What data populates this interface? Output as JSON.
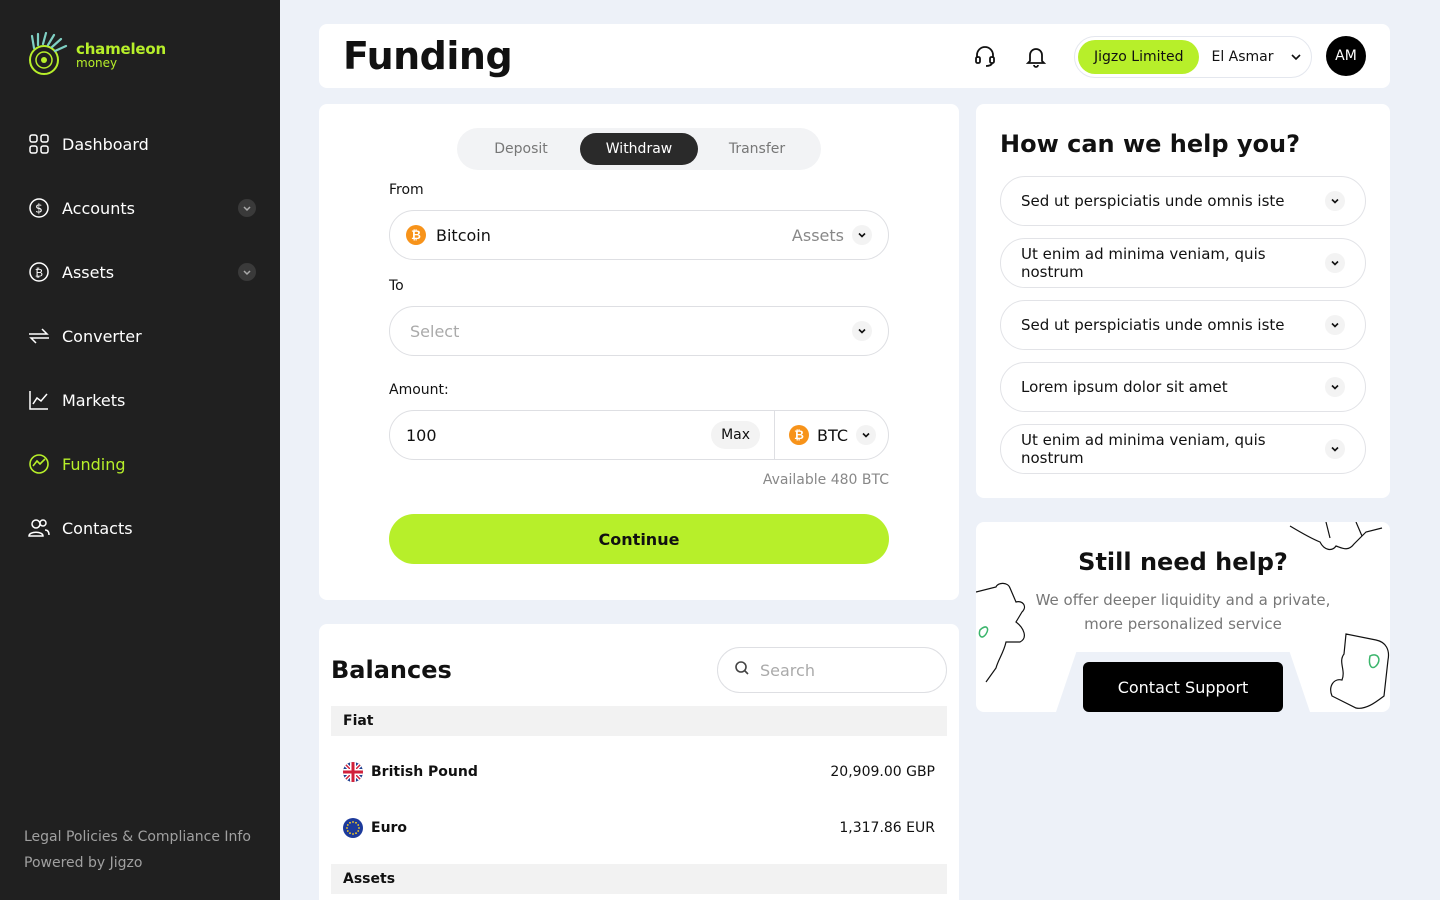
{
  "brand": {
    "name": "chameleon",
    "sub": "money"
  },
  "sidebar": {
    "items": [
      {
        "label": "Dashboard",
        "icon": "grid-icon"
      },
      {
        "label": "Accounts",
        "icon": "dollar-icon"
      },
      {
        "label": "Assets",
        "icon": "bitcoin-icon"
      },
      {
        "label": "Converter",
        "icon": "arrows-icon"
      },
      {
        "label": "Markets",
        "icon": "chart-icon"
      },
      {
        "label": "Funding",
        "icon": "funding-icon"
      },
      {
        "label": "Contacts",
        "icon": "users-icon"
      }
    ],
    "footer": {
      "legal": "Legal Policies & Compliance Info",
      "powered": "Powered by Jigzo"
    }
  },
  "header": {
    "title": "Funding",
    "org_badge": "Jigzo Limited",
    "org_user": "El Asmar",
    "avatar": "AM"
  },
  "funding": {
    "tabs": [
      "Deposit",
      "Withdraw",
      "Transfer"
    ],
    "active_tab": "Withdraw",
    "from_label": "From",
    "from_value": "Bitcoin",
    "from_type": "Assets",
    "to_label": "To",
    "to_placeholder": "Select",
    "amount_label": "Amount:",
    "amount_value": "100",
    "max_label": "Max",
    "currency": "BTC",
    "available": "Available 480 BTC",
    "continue_label": "Continue"
  },
  "balances": {
    "title": "Balances",
    "search_placeholder": "Search",
    "fiat_label": "Fiat",
    "assets_label": "Assets",
    "fiat": [
      {
        "name": "British Pound",
        "amount": "20,909.00 GBP"
      },
      {
        "name": "Euro",
        "amount": "1,317.86 EUR"
      }
    ]
  },
  "help": {
    "title": "How can we help you?",
    "faqs": [
      "Sed ut perspiciatis unde omnis iste",
      "Ut enim ad minima veniam, quis nostrum",
      "Sed ut perspiciatis unde omnis iste",
      "Lorem ipsum dolor sit amet",
      "Ut enim ad minima veniam, quis nostrum"
    ]
  },
  "support": {
    "title": "Still need help?",
    "text": "We offer deeper liquidity and a private, more personalized service",
    "button": "Contact Support"
  },
  "colors": {
    "accent": "#b7ef2a",
    "sidebar": "#202020",
    "bitcoin": "#f7931a"
  }
}
